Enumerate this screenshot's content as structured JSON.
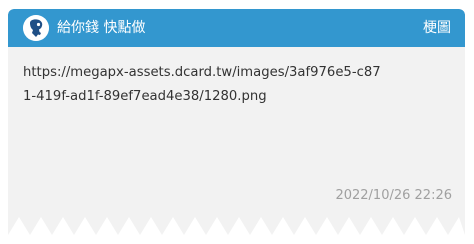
{
  "header": {
    "forum_name": "給你錢 快點做",
    "board_link_label": "梗圖",
    "avatar_icon": "forum-avatar-icon",
    "accent_color": "#3397cf"
  },
  "post": {
    "body_lines": [
      "https://megapx-assets.dcard.tw/images/3af976e5-c87",
      "1-419f-ad1f-89ef7ead4e38/1280.png"
    ],
    "timestamp": "2022/10/26 22:26"
  }
}
